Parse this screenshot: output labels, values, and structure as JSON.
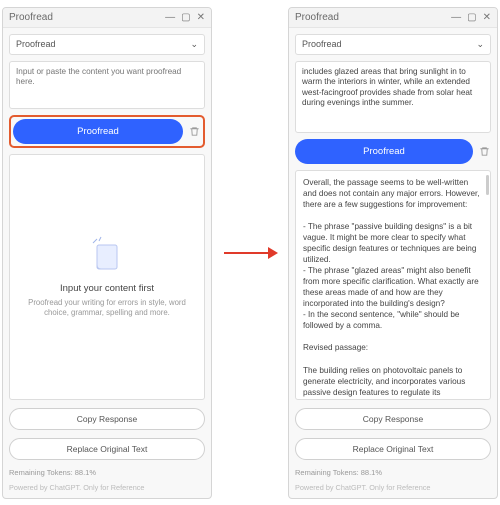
{
  "left": {
    "title": "Proofread",
    "dropdown": "Proofread",
    "input_placeholder": "Input or paste the content you want proofread here.",
    "proofread_btn": "Proofread",
    "empty_title": "Input your content first",
    "empty_sub": "Proofread your writing for errors in style, word choice, grammar, spelling and more.",
    "copy_btn": "Copy Response",
    "replace_btn": "Replace Original Text",
    "tokens": "Remaining Tokens: 88.1%",
    "powered": "Powered by ChatGPT. Only for Reference"
  },
  "right": {
    "title": "Proofread",
    "dropdown": "Proofread",
    "input_text": "includes glazed areas\nthat bring sunlight in to warm the interiors in winter, while an extended west-facingroof provides shade from solar heat during evenings\ninthe summer.",
    "proofread_btn": "Proofread",
    "output_text": "Overall, the passage seems to be well-written and does not contain any major errors. However, there are a few suggestions for improvement:\n\n- The phrase \"passive building designs\" is a bit vague. It might be more clear to specify what specific design features or techniques are being utilized.\n- The phrase \"glazed areas\" might also benefit from more specific clarification. What exactly are these areas made of and how are they incorporated into the building's design?\n- In the second sentence, \"while\" should be followed by a comma.\n\nRevised passage:\n\nThe building relies on photovoltaic panels to generate electricity, and incorporates various passive design features to regulate its temperature. These include strategically placed glazing to admit sunlight and warm",
    "copy_btn": "Copy Response",
    "replace_btn": "Replace Original Text",
    "tokens": "Remaining Tokens: 88.1%",
    "powered": "Powered by ChatGPT. Only for Reference"
  }
}
